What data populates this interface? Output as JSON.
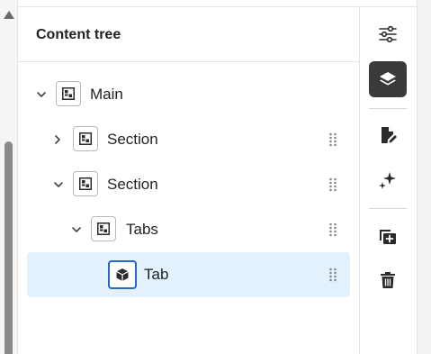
{
  "panel": {
    "title": "Content tree"
  },
  "tree": [
    {
      "label": "Main",
      "expanded": true,
      "icon": "layout-grid-icon",
      "selected": false
    },
    {
      "label": "Section",
      "expanded": false,
      "icon": "layout-grid-icon",
      "selected": false
    },
    {
      "label": "Section",
      "expanded": true,
      "icon": "layout-grid-icon",
      "selected": false
    },
    {
      "label": "Tabs",
      "expanded": true,
      "icon": "layout-grid-icon",
      "selected": false
    },
    {
      "label": "Tab",
      "expanded": null,
      "icon": "cube-icon",
      "selected": true
    }
  ],
  "toolbar": {
    "items": [
      {
        "name": "properties",
        "icon": "sliders-icon",
        "active": false
      },
      {
        "name": "content-tree",
        "icon": "layers-icon",
        "active": true
      },
      {
        "name": "edit",
        "icon": "edit-document-icon",
        "active": false
      },
      {
        "name": "generate",
        "icon": "sparkle-icon",
        "active": false
      },
      {
        "name": "add",
        "icon": "add-component-icon",
        "active": false
      },
      {
        "name": "delete",
        "icon": "trash-icon",
        "active": false
      }
    ]
  },
  "colors": {
    "selected_row": "#e3f1fd",
    "selected_icon_border": "#2668c9",
    "active_tool": "#3a3a3a"
  }
}
